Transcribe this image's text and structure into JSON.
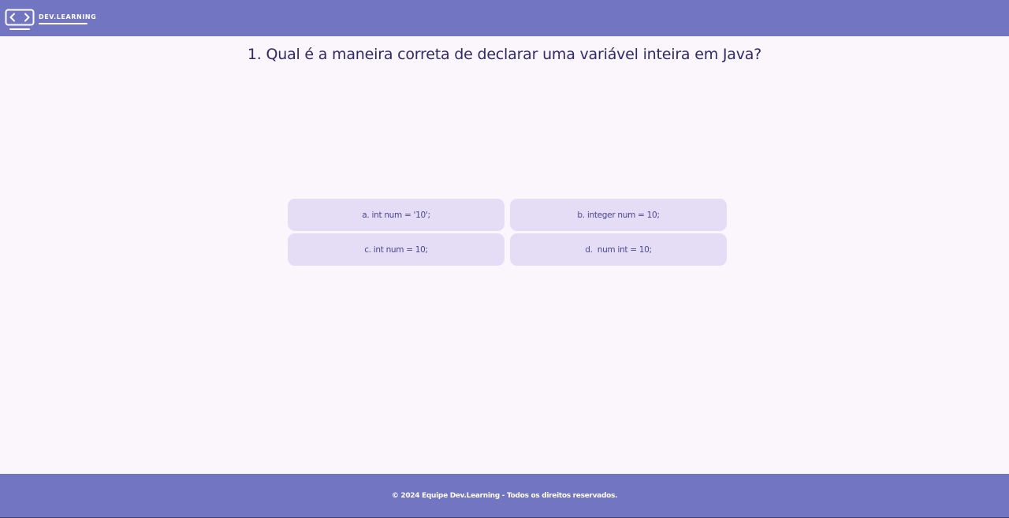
{
  "header": {
    "logo_text": "DEV.LEARNING",
    "logo_icon": "code-brackets-monitor-icon",
    "background_color": "#7275c1"
  },
  "quiz": {
    "question": "1. Qual é a maneira correta de declarar uma variável inteira em Java?",
    "options": [
      {
        "label": "a. int num = '10';"
      },
      {
        "label": "b. integer num = 10;"
      },
      {
        "label": "c. int num = 10;"
      },
      {
        "label": "d.  num int = 10;"
      }
    ],
    "option_color": "#e5ddf6",
    "question_color": "#2e2a6b"
  },
  "footer": {
    "text": "© 2024 Equipe Dev.Learning - Todos os direitos reservados.",
    "background_color": "#7275c1"
  }
}
